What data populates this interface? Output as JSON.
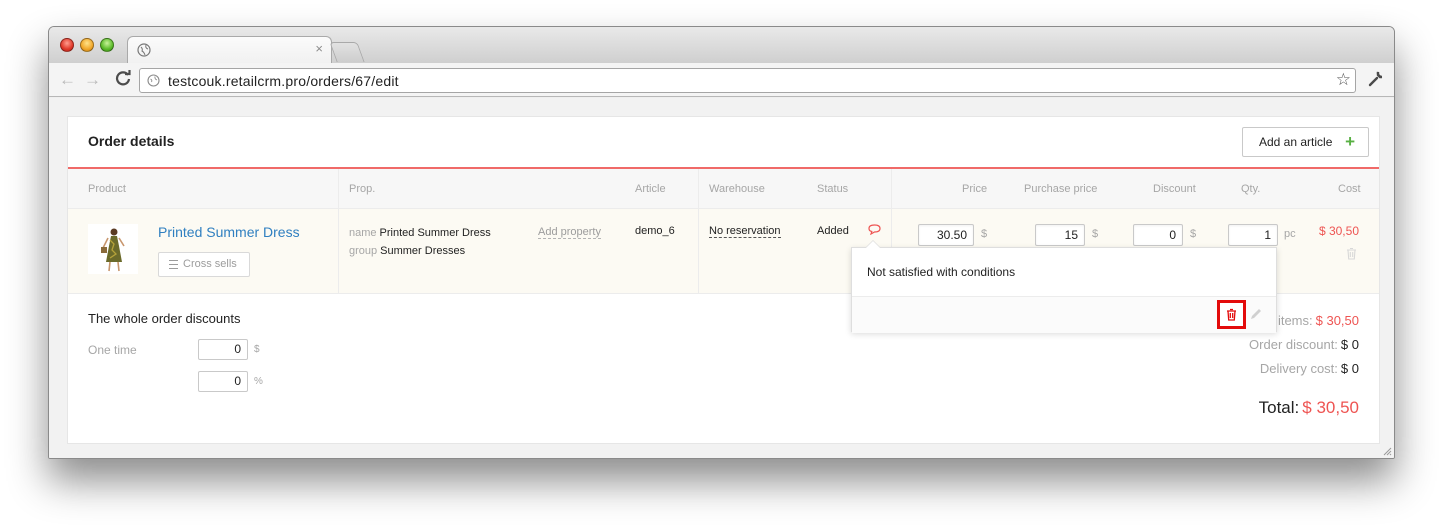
{
  "browser": {
    "url_host": "testcouk.retailcrm.pro",
    "url_path": "/orders/67/edit",
    "tab_close": "×",
    "back": "←",
    "forward": "→",
    "reload": "C",
    "star": "☆"
  },
  "card": {
    "title": "Order details",
    "add_article_label": "Add an article",
    "add_article_icon": "+"
  },
  "table": {
    "headers": {
      "product": "Product",
      "prop": "Prop.",
      "article": "Article",
      "warehouse": "Warehouse",
      "status": "Status",
      "price": "Price",
      "purchase_price": "Purchase price",
      "discount": "Discount",
      "qty": "Qty.",
      "cost": "Cost"
    },
    "row": {
      "product_name": "Printed Summer Dress",
      "cross_sells": "Cross sells",
      "props": [
        {
          "key": "name",
          "value": "Printed Summer Dress"
        },
        {
          "key": "group",
          "value": "Summer Dresses"
        }
      ],
      "add_property": "Add property",
      "article": "demo_6",
      "warehouse": "No reservation",
      "status": "Added",
      "price": "30.50",
      "price_unit": "$",
      "purchase_price": "15",
      "purchase_unit": "$",
      "discount": "0",
      "discount_unit": "$",
      "qty": "1",
      "qty_unit": "pc",
      "cost": "$ 30,50"
    }
  },
  "popup": {
    "text": "Not satisfied with conditions"
  },
  "discounts": {
    "title": "The whole order discounts",
    "one_time_label": "One time",
    "amount_value": "0",
    "amount_unit": "$",
    "percent_value": "0",
    "percent_unit": "%"
  },
  "summary": {
    "items_label": "items:",
    "items_value": "$ 30,50",
    "order_discount_label": "Order discount:",
    "order_discount_value": "$ 0",
    "delivery_label": "Delivery cost:",
    "delivery_value": "$ 0",
    "total_label": "Total:",
    "total_value": "$ 30,50"
  },
  "colors": {
    "accent_red": "#ee5452",
    "divider_red": "#f06a68",
    "link_blue": "#2f7fc0",
    "plus_green": "#58b043",
    "highlight_red": "#e30b0b"
  }
}
